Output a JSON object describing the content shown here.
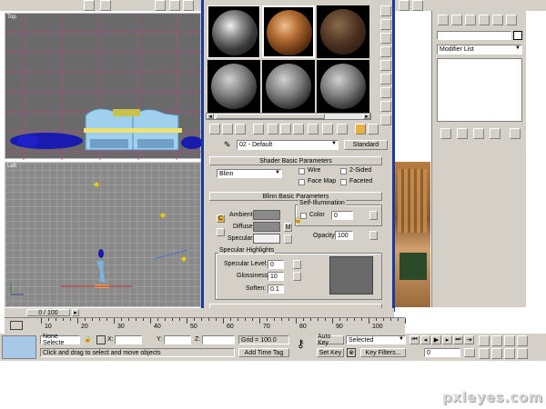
{
  "viewports": {
    "top_label": "Top",
    "left_label": "Left",
    "frame_counter": "0 / 100"
  },
  "modifier_panel": {
    "modifier_list": "Modifier List"
  },
  "material_editor": {
    "material_name": "02 - Default",
    "material_type": "Standard",
    "shader_rollout_title": "Shader Basic Parameters",
    "shader_type": "Blinn",
    "wire_label": "Wire",
    "two_sided_label": "2-Sided",
    "face_map_label": "Face Map",
    "faceted_label": "Faceted",
    "blinn_rollout_title": "Blinn Basic Parameters",
    "self_illum_label": "Self-Illumination",
    "color_label": "Color",
    "color_value": "0",
    "ambient_label": "Ambient:",
    "diffuse_label": "Diffuse:",
    "specular_label": "Specular:",
    "c_lock": "C",
    "m_button": "M",
    "opacity_label": "Opacity:",
    "opacity_value": "100",
    "specular_highlights_label": "Specular Highlights",
    "specular_level_label": "Specular Level:",
    "specular_level_value": "0",
    "glossiness_label": "Glossiness:",
    "glossiness_value": "10",
    "soften_label": "Soften:",
    "soften_value": "0.1"
  },
  "timeline": {
    "ticks": [
      "10",
      "20",
      "30",
      "40",
      "50",
      "60",
      "70",
      "80",
      "90",
      "100"
    ]
  },
  "status": {
    "selection": "None Selecte",
    "x_label": "X:",
    "y_label": "Y:",
    "z_label": "Z:",
    "grid": "Grid = 100.0",
    "prompt": "Click and drag to select and move objects",
    "add_time_tag": "Add Time Tag",
    "auto_key": "Auto Key",
    "set_key": "Set Key",
    "selected": "Selected",
    "key_filters": "Key Filters...",
    "frame_value": "0"
  },
  "watermark": "pxleyes.com"
}
